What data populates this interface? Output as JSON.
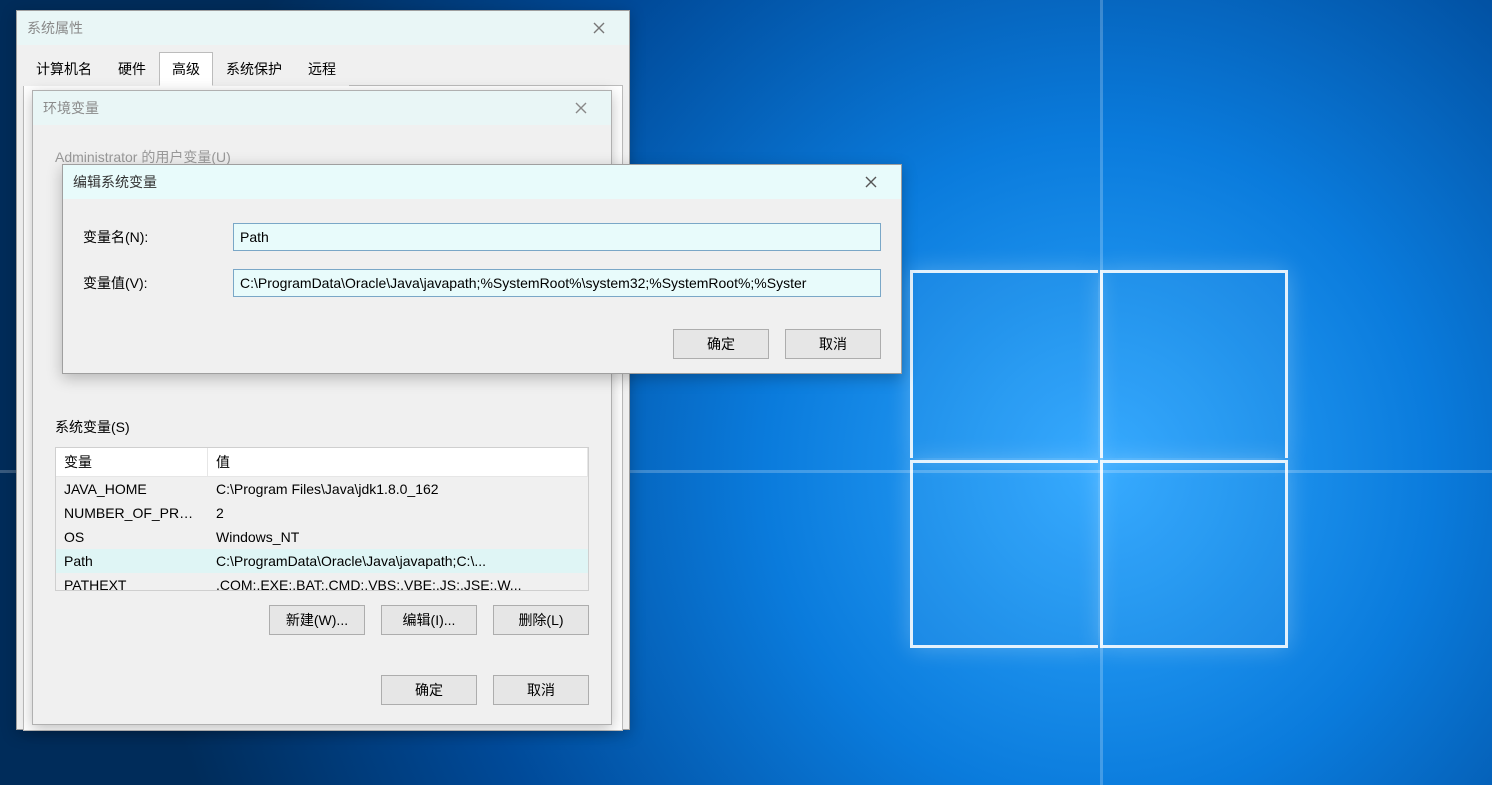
{
  "sysprops": {
    "title": "系统属性",
    "tabs": [
      "计算机名",
      "硬件",
      "高级",
      "系统保护",
      "远程"
    ],
    "active_tab_index": 2
  },
  "envvars": {
    "title": "环境变量",
    "user_section_label": "Administrator 的用户变量(U)",
    "sys_section_label": "系统变量(S)",
    "col_name": "变量",
    "col_value": "值",
    "sys_rows": [
      {
        "name": "JAVA_HOME",
        "value": "C:\\Program Files\\Java\\jdk1.8.0_162"
      },
      {
        "name": "NUMBER_OF_PRO...",
        "value": "2"
      },
      {
        "name": "OS",
        "value": "Windows_NT"
      },
      {
        "name": "Path",
        "value": "C:\\ProgramData\\Oracle\\Java\\javapath;C:\\..."
      },
      {
        "name": "PATHEXT",
        "value": ".COM;.EXE;.BAT;.CMD;.VBS;.VBE;.JS;.JSE;.W..."
      }
    ],
    "btn_new": "新建(W)...",
    "btn_edit": "编辑(I)...",
    "btn_delete": "删除(L)",
    "btn_ok": "确定",
    "btn_cancel": "取消"
  },
  "editdlg": {
    "title": "编辑系统变量",
    "label_name": "变量名(N):",
    "label_value": "变量值(V):",
    "name_value": "Path",
    "value_value": "C:\\ProgramData\\Oracle\\Java\\javapath;%SystemRoot%\\system32;%SystemRoot%;%Syster",
    "btn_ok": "确定",
    "btn_cancel": "取消"
  }
}
